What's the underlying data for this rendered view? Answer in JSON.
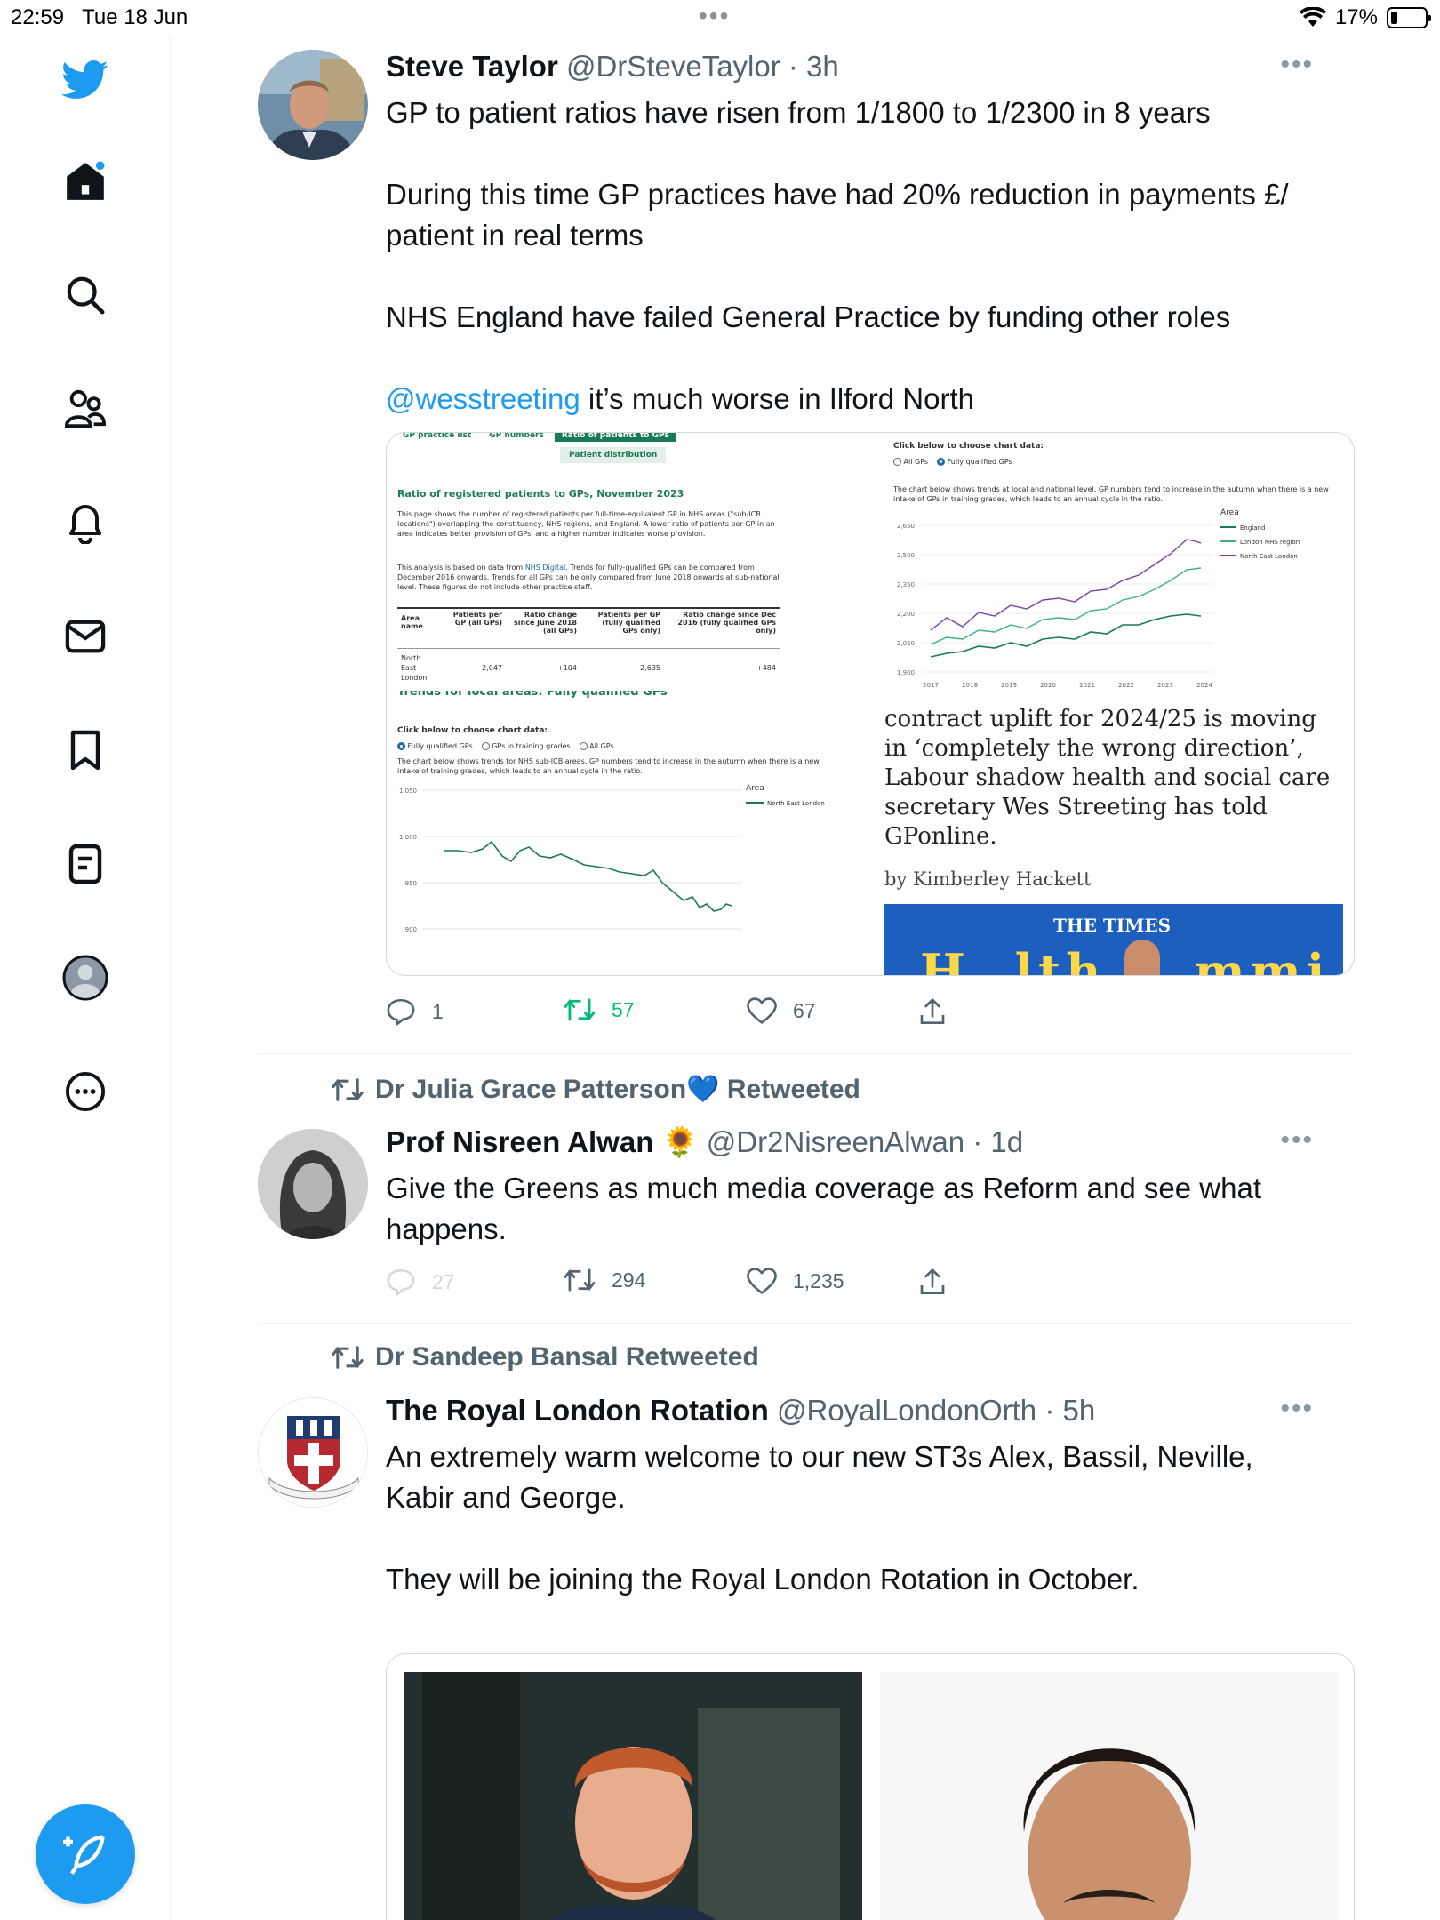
{
  "status_bar": {
    "time": "22:59",
    "date": "Tue 18 Jun",
    "battery": "17%"
  },
  "tweets": [
    {
      "name": "Steve Taylor",
      "handle": "@DrSteveTaylor",
      "time": "· 3h",
      "lines": [
        "GP to patient ratios have risen from 1/1800 to 1/2300 in 8 years",
        "During this time GP practices have had 20% reduction in payments £/",
        "patient in real terms",
        "NHS England have failed General Practice by funding other roles",
        "@wesstreeting",
        " it’s much worse in Ilford North"
      ],
      "replies": "1",
      "retweets": "57",
      "likes": "67"
    },
    {
      "retweeted_by": "Dr Julia Grace Patterson💙 Retweeted",
      "name": "Prof Nisreen Alwan",
      "name_emoji": "🌻",
      "handle": "@Dr2NisreenAlwan",
      "time": "· 1d",
      "lines": [
        "Give the Greens as much media coverage as Reform and see what",
        "happens."
      ],
      "replies": "27",
      "retweets": "294",
      "likes": "1,235"
    },
    {
      "retweeted_by": "Dr Sandeep Bansal Retweeted",
      "name": "The Royal London Rotation",
      "handle": "@RoyalLondonOrth",
      "time": "· 5h",
      "lines": [
        "An extremely warm welcome to our new ST3s Alex, Bassil, Neville,",
        "Kabir and George.",
        "They will be joining the Royal London Rotation in October."
      ]
    }
  ],
  "embedded_screenshot": {
    "tabs": [
      "GP practice list",
      "GP numbers",
      "Ratio of patients to GPs",
      "Patient distribution"
    ],
    "title": "Ratio of registered patients to GPs, November 2023",
    "para1": "This page shows the number of registered patients per full-time-equivalent GP in NHS areas (\"sub-ICB locations\") overlapping the constituency, NHS regions, and England. A lower ratio of patients per GP in an area indicates better provision of GPs, and a higher number indicates worse provision.",
    "para2_a": "This analysis is based on data from ",
    "para2_link": "NHS Digital",
    "para2_b": ". Trends for fully-qualified GPs can be compared from December 2016 onwards. Trends for all GPs can be only compared from June 2018 onwards at sub-national level. These figures do not include other practice staff.",
    "table_headers": [
      "Area name",
      "Patients per GP (all GPs)",
      "Ratio change since June 2018 (all GPs)",
      "Patients per GP (fully qualified GPs only)",
      "Ratio change since Dec 2016 (fully qualified GPs only)"
    ],
    "table_row": [
      "North East London",
      "2,047",
      "+104",
      "2,635",
      "+484"
    ],
    "section_title": "Trends for local areas: Fully qualified GPs",
    "choose_label": "Click below to choose chart data:",
    "radio_local": [
      "Fully qualified GPs",
      "GPs in training grades",
      "All GPs"
    ],
    "local_note": "The chart below shows trends for NHS sub-ICB areas. GP numbers tend to increase in the autumn when there is a new intake of training grades, which leads to an annual cycle in the ratio.",
    "local_legend_title": "Area",
    "local_legend": [
      "North East London"
    ],
    "local_yticks": [
      "1,050",
      "1,000",
      "950",
      "900"
    ],
    "radio_national": [
      "All GPs",
      "Fully qualified GPs"
    ],
    "national_note": "The chart below shows trends at local and national level. GP numbers tend to increase in the autumn when there is a new intake of GPs in training grades, which leads to an annual cycle in the ratio.",
    "national_legend_title": "Area",
    "national_legend": [
      "England",
      "London NHS region",
      "North East London"
    ],
    "national_yticks": [
      "2,650",
      "2,500",
      "2,350",
      "2,200",
      "2,050",
      "1,900"
    ],
    "national_xticks": [
      "2017",
      "2018",
      "2019",
      "2020",
      "2021",
      "2022",
      "2023",
      "2024"
    ],
    "article_text": [
      "contract uplift for 2024/25 is moving",
      "in ‘completely the wrong direction’,",
      "Labour shadow health and social care",
      "secretary Wes Streeting has told",
      "GPonline."
    ],
    "byline": "by Kimberley Hackett",
    "banner_text": "THE TIMES"
  },
  "colors": {
    "accent": "#1d9bf0",
    "retweet_green": "#00ba7c",
    "england": "#1a7a55",
    "london": "#3fb08a",
    "north_east_london": "#7b3fa0"
  }
}
